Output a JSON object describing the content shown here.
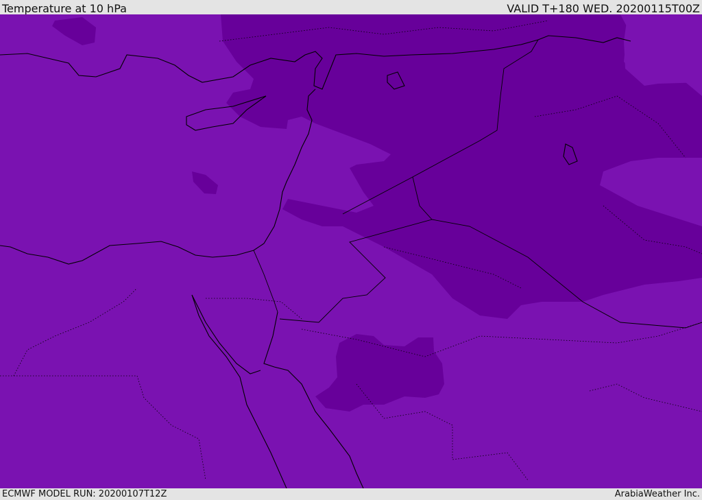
{
  "header": {
    "title": "Temperature at 10 hPa",
    "valid": "VALID T+180 WED. 20200115T00Z"
  },
  "footer": {
    "model_run": "ECMWF MODEL RUN: 20200107T12Z",
    "credit": "ArabiaWeather Inc."
  },
  "colors": {
    "field_light": "#7a12b1",
    "field_dark": "#67009a",
    "coast": "#000000"
  }
}
